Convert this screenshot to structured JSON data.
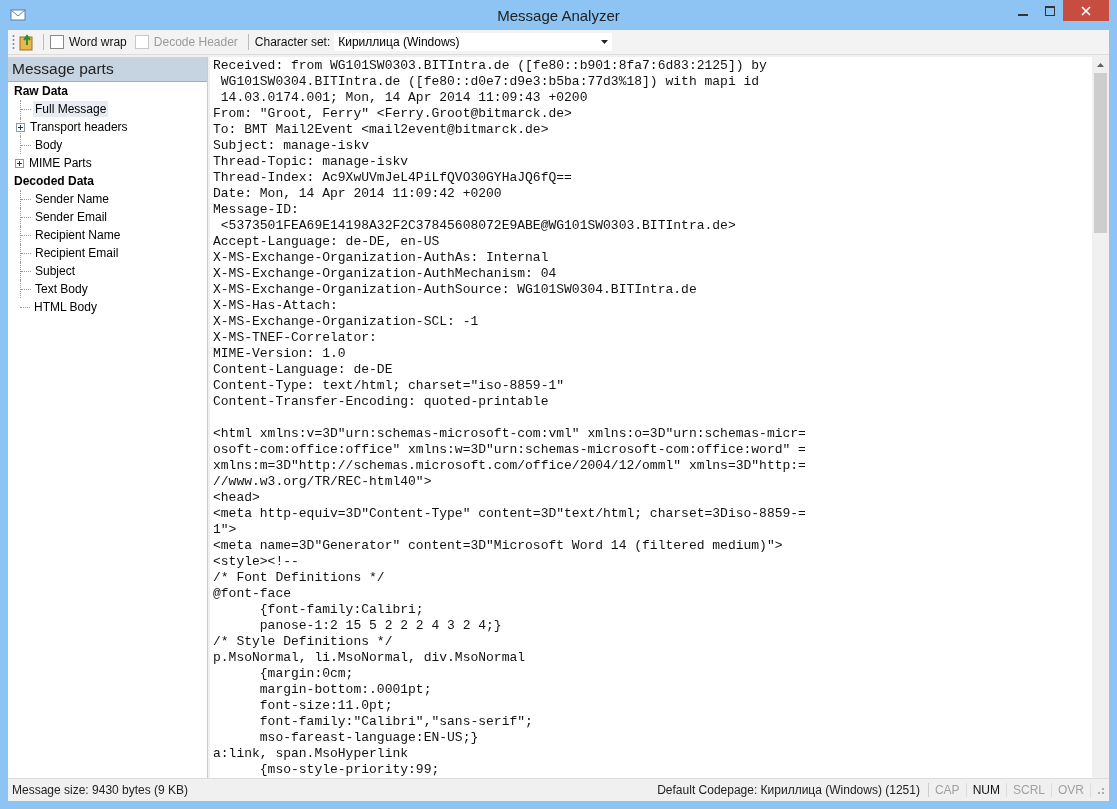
{
  "window": {
    "title": "Message Analyzer"
  },
  "toolbar": {
    "checkboxes": [
      {
        "label": "Word wrap",
        "checked": false,
        "disabled": false
      },
      {
        "label": "Decode Header",
        "checked": false,
        "disabled": true
      }
    ],
    "charset_label": "Character set:",
    "charset_value": "Кириллица (Windows)"
  },
  "sidebar": {
    "title": "Message parts",
    "groups": [
      {
        "label": "Raw Data",
        "children": [
          {
            "label": "Full Message",
            "selected": true,
            "expandable": false
          },
          {
            "label": "Transport headers",
            "selected": false,
            "expandable": true
          },
          {
            "label": "Body",
            "selected": false,
            "expandable": false
          },
          {
            "label": "MIME Parts",
            "selected": false,
            "expandable": true
          }
        ]
      },
      {
        "label": "Decoded Data",
        "children": [
          {
            "label": "Sender Name",
            "selected": false,
            "expandable": false
          },
          {
            "label": "Sender Email",
            "selected": false,
            "expandable": false
          },
          {
            "label": "Recipient Name",
            "selected": false,
            "expandable": false
          },
          {
            "label": "Recipient Email",
            "selected": false,
            "expandable": false
          },
          {
            "label": "Subject",
            "selected": false,
            "expandable": false
          },
          {
            "label": "Text Body",
            "selected": false,
            "expandable": false
          },
          {
            "label": "HTML Body",
            "selected": false,
            "expandable": false
          }
        ]
      }
    ]
  },
  "message": {
    "header_lines": [
      "Received: from WG101SW0303.BITIntra.de ([fe80::b901:8fa7:6d83:2125]) by",
      " WG101SW0304.BITIntra.de ([fe80::d0e7:d9e3:b5ba:77d3%18]) with mapi id",
      " 14.03.0174.001; Mon, 14 Apr 2014 11:09:43 +0200",
      "From: \"Groot, Ferry\" <Ferry.Groot@bitmarck.de>",
      "To: BMT Mail2Event <mail2event@bitmarck.de>",
      "Subject: manage-iskv",
      "Thread-Topic: manage-iskv",
      "Thread-Index: Ac9XwUVmJeL4PiLfQVO30GYHaJQ6fQ==",
      "Date: Mon, 14 Apr 2014 11:09:42 +0200",
      "Message-ID:",
      " <5373501FEA69E14198A32F2C37845608072E9ABE@WG101SW0303.BITIntra.de>",
      "Accept-Language: de-DE, en-US",
      "X-MS-Exchange-Organization-AuthAs: Internal",
      "X-MS-Exchange-Organization-AuthMechanism: 04",
      "X-MS-Exchange-Organization-AuthSource: WG101SW0304.BITIntra.de",
      "X-MS-Has-Attach:",
      "X-MS-Exchange-Organization-SCL: -1",
      "X-MS-TNEF-Correlator:",
      "MIME-Version: 1.0",
      "Content-Language: de-DE",
      "Content-Type: text/html; charset=\"iso-8859-1\"",
      "Content-Transfer-Encoding: quoted-printable"
    ],
    "body_lines": [
      "<html xmlns:v=3D\"urn:schemas-microsoft-com:vml\" xmlns:o=3D\"urn:schemas-micr=",
      "osoft-com:office:office\" xmlns:w=3D\"urn:schemas-microsoft-com:office:word\" =",
      "xmlns:m=3D\"http://schemas.microsoft.com/office/2004/12/omml\" xmlns=3D\"http:=",
      "//www.w3.org/TR/REC-html40\">",
      "<head>",
      "<meta http-equiv=3D\"Content-Type\" content=3D\"text/html; charset=3Diso-8859-=",
      "1\">",
      "<meta name=3D\"Generator\" content=3D\"Microsoft Word 14 (filtered medium)\">",
      "<style><!--",
      "/* Font Definitions */",
      "@font-face",
      "      {font-family:Calibri;",
      "      panose-1:2 15 5 2 2 2 4 3 2 4;}",
      "/* Style Definitions */",
      "p.MsoNormal, li.MsoNormal, div.MsoNormal",
      "      {margin:0cm;",
      "      margin-bottom:.0001pt;",
      "      font-size:11.0pt;",
      "      font-family:\"Calibri\",\"sans-serif\";",
      "      mso-fareast-language:EN-US;}",
      "a:link, span.MsoHyperlink",
      "      {mso-style-priority:99;"
    ]
  },
  "status_bar": {
    "size": "Message size: 9430 bytes (9 KB)",
    "codepage": "Default Codepage: Кириллица (Windows) (1251)",
    "indicators": [
      {
        "label": "CAP",
        "on": false
      },
      {
        "label": "NUM",
        "on": true
      },
      {
        "label": "SCRL",
        "on": false
      },
      {
        "label": "OVR",
        "on": false
      }
    ]
  }
}
